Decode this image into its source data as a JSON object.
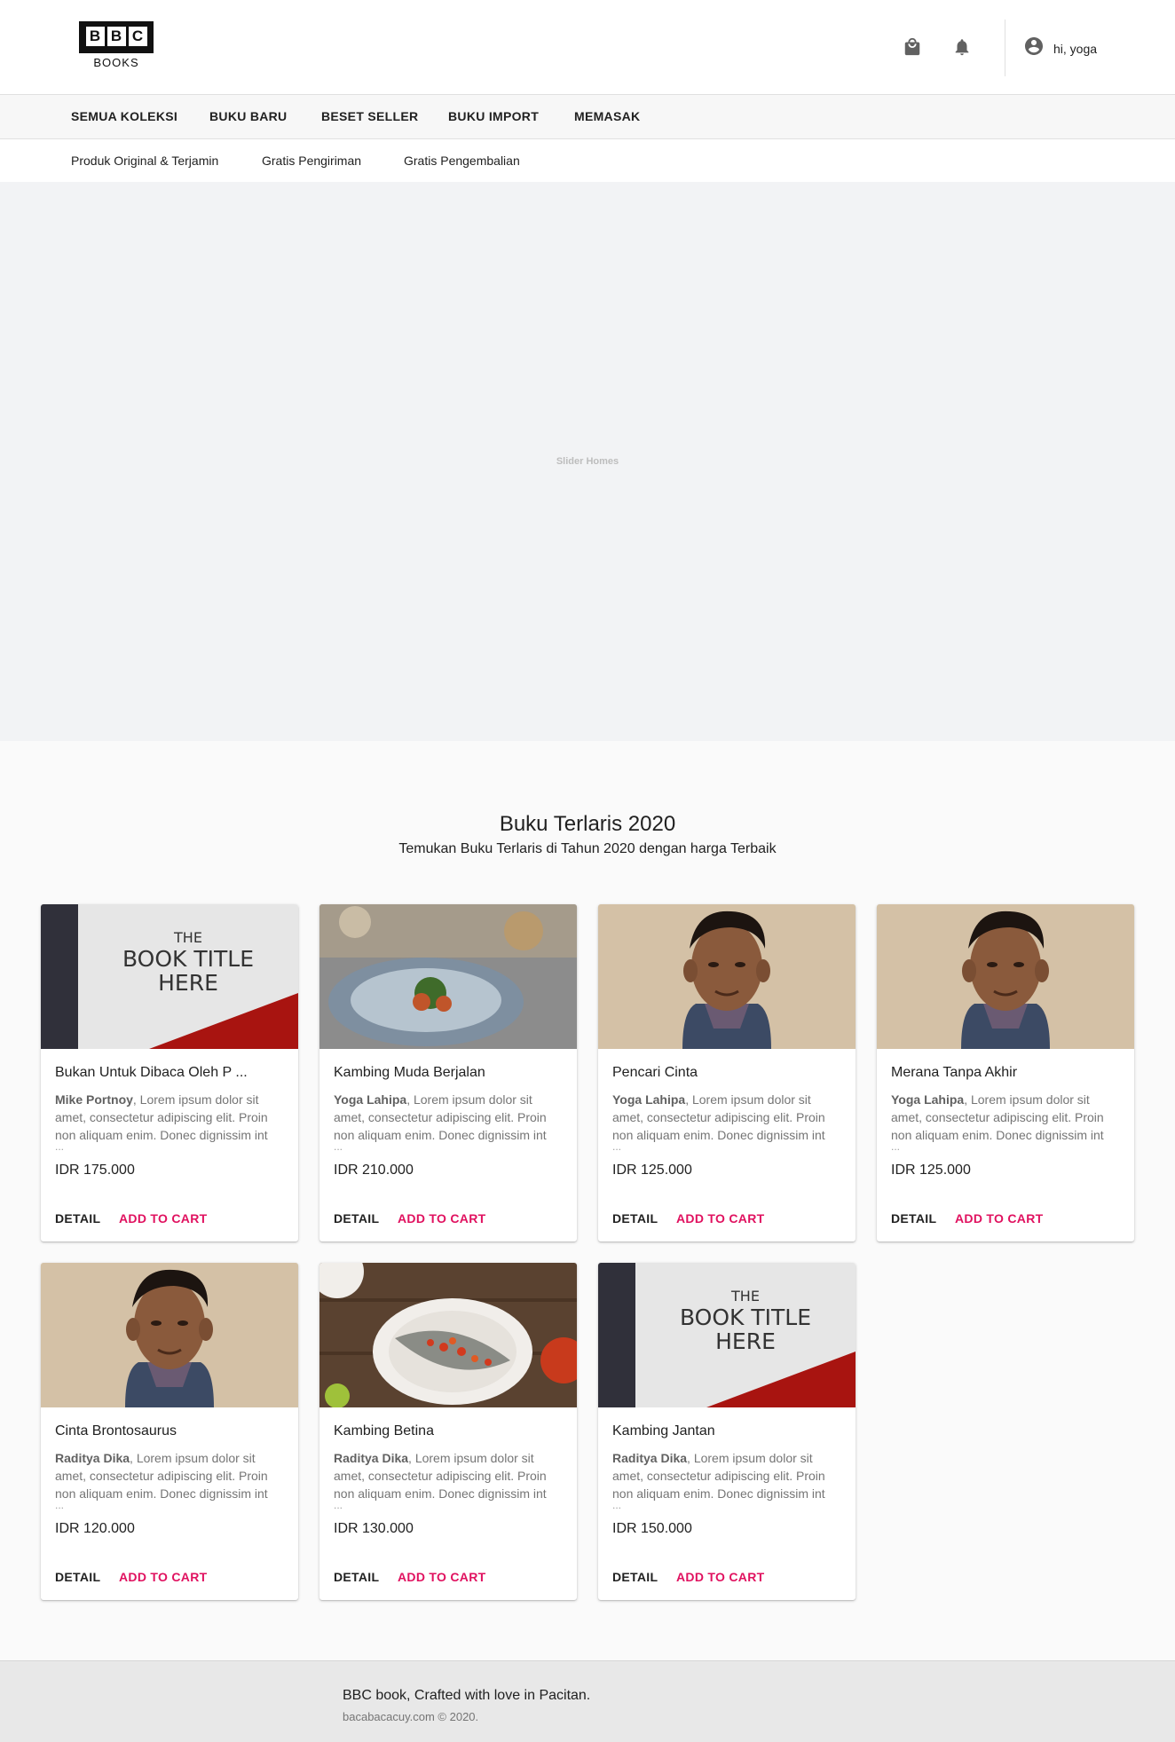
{
  "brand": {
    "letters": [
      "B",
      "B",
      "C"
    ],
    "sub": "BOOKS"
  },
  "header": {
    "user_label": "hi, yoga",
    "icons": [
      "shopping-bag-icon",
      "bell-icon",
      "account-circle-icon"
    ]
  },
  "nav": {
    "items": [
      "SEMUA KOLEKSI",
      "BUKU BARU",
      "BESET SELLER",
      "BUKU IMPORT",
      "MEMASAK"
    ]
  },
  "sub_nav": {
    "items": [
      "Produk Original & Terjamin",
      "Gratis Pengiriman",
      "Gratis Pengembalian"
    ]
  },
  "slider": {
    "label": "Slider Homes"
  },
  "section": {
    "title": "Buku Terlaris 2020",
    "subtitle": "Temukan Buku Terlaris di Tahun 2020 dengan harga Terbaik"
  },
  "cover_text": {
    "line1": "THE",
    "line2": "BOOK TITLE",
    "line3": "HERE"
  },
  "books": [
    {
      "title": "Bukan Untuk Dibaca Oleh P ...",
      "author": "Mike Portnoy",
      "desc": ", Lorem ipsum dolor sit amet, consectetur adipiscing elit. Proin non aliquam enim. Donec dignissim int",
      "ellipsis": "...",
      "price": "IDR 175.000",
      "thumb": "cover",
      "detail": "DETAIL",
      "cart": "ADD TO CART"
    },
    {
      "title": "Kambing Muda Berjalan",
      "author": "Yoga Lahipa",
      "desc": ", Lorem ipsum dolor sit amet, consectetur adipiscing elit. Proin non aliquam enim. Donec dignissim int",
      "ellipsis": "...",
      "price": "IDR 210.000",
      "thumb": "food-plate",
      "detail": "DETAIL",
      "cart": "ADD TO CART"
    },
    {
      "title": "Pencari Cinta",
      "author": "Yoga Lahipa",
      "desc": ", Lorem ipsum dolor sit amet, consectetur adipiscing elit. Proin non aliquam enim. Donec dignissim int",
      "ellipsis": "...",
      "price": "IDR 125.000",
      "thumb": "portrait",
      "detail": "DETAIL",
      "cart": "ADD TO CART"
    },
    {
      "title": "Merana Tanpa Akhir",
      "author": "Yoga Lahipa",
      "desc": ", Lorem ipsum dolor sit amet, consectetur adipiscing elit. Proin non aliquam enim. Donec dignissim int",
      "ellipsis": "...",
      "price": "IDR 125.000",
      "thumb": "portrait",
      "detail": "DETAIL",
      "cart": "ADD TO CART"
    },
    {
      "title": "Cinta Brontosaurus",
      "author": "Raditya Dika",
      "desc": ", Lorem ipsum dolor sit amet, consectetur adipiscing elit. Proin non aliquam enim. Donec dignissim int",
      "ellipsis": "...",
      "price": "IDR 120.000",
      "thumb": "portrait",
      "detail": "DETAIL",
      "cart": "ADD TO CART"
    },
    {
      "title": "Kambing Betina",
      "author": "Raditya Dika",
      "desc": ", Lorem ipsum dolor sit amet, consectetur adipiscing elit. Proin non aliquam enim. Donec dignissim int",
      "ellipsis": "...",
      "price": "IDR 130.000",
      "thumb": "fish-dish",
      "detail": "DETAIL",
      "cart": "ADD TO CART"
    },
    {
      "title": "Kambing Jantan",
      "author": "Raditya Dika",
      "desc": ", Lorem ipsum dolor sit amet, consectetur adipiscing elit. Proin non aliquam enim. Donec dignissim int",
      "ellipsis": "...",
      "price": "IDR 150.000",
      "thumb": "cover",
      "detail": "DETAIL",
      "cart": "ADD TO CART"
    }
  ],
  "footer": {
    "line1": "BBC book, Crafted with love in Pacitan.",
    "line2": "bacabacacuy.com © 2020."
  },
  "colors": {
    "accent": "#e0115f",
    "cover_red": "#a81410",
    "spine": "#30303a"
  }
}
